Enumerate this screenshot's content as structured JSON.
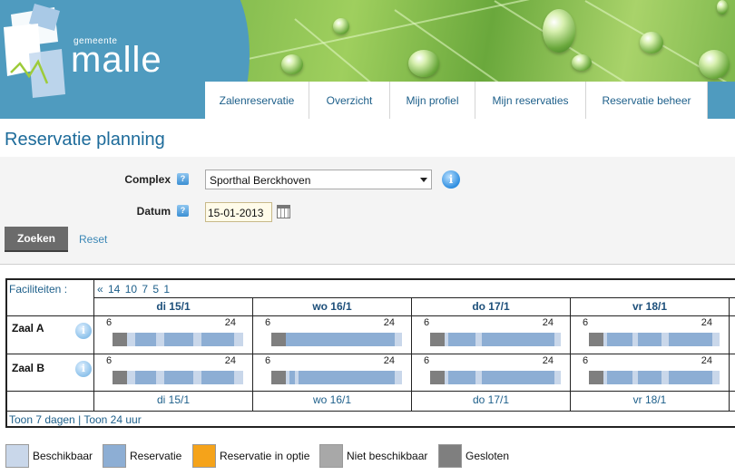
{
  "header": {
    "logo_small": "gemeente",
    "logo_big": "malle"
  },
  "nav": [
    {
      "label": "Zalenreservatie"
    },
    {
      "label": "Overzicht"
    },
    {
      "label": "Mijn profiel"
    },
    {
      "label": "Mijn reservaties"
    },
    {
      "label": "Reservatie beheer"
    }
  ],
  "page_title": "Reservatie planning",
  "form": {
    "complex_label": "Complex",
    "complex_value": "Sporthal Berckhoven",
    "datum_label": "Datum",
    "datum_value": "15-01-2013",
    "search_button": "Zoeken",
    "reset_link": "Reset"
  },
  "grid": {
    "facilities_label": "Faciliteiten :",
    "pager": "«  14  10  7  5  1",
    "days": [
      "di 15/1",
      "wo 16/1",
      "do 17/1",
      "vr 18/1"
    ],
    "rooms": [
      {
        "name": "Zaal A",
        "slots": [
          {
            "start_label": "6",
            "end_label": "24"
          },
          {
            "start_label": "6",
            "end_label": "24"
          },
          {
            "start_label": "6",
            "end_label": "24"
          },
          {
            "start_label": "6",
            "end_label": "24"
          }
        ]
      },
      {
        "name": "Zaal B",
        "slots": [
          {
            "start_label": "6",
            "end_label": "24"
          },
          {
            "start_label": "6",
            "end_label": "24"
          },
          {
            "start_label": "6",
            "end_label": "24"
          },
          {
            "start_label": "6",
            "end_label": "24"
          }
        ]
      }
    ],
    "footer_link_1": "Toon 7 dagen",
    "footer_sep": " | ",
    "footer_link_2": "Toon 24 uur"
  },
  "legend": [
    {
      "label": "Beschikbaar",
      "color": "#c9d7ea"
    },
    {
      "label": "Reservatie",
      "color": "#8daed4"
    },
    {
      "label": "Reservatie in optie",
      "color": "#f5a31a"
    },
    {
      "label": "Niet beschikbaar",
      "color": "#a8a8a8"
    },
    {
      "label": "Gesloten",
      "color": "#7f7f7f"
    }
  ],
  "icons": {
    "help": "help-icon",
    "info": "info-icon",
    "calendar": "calendar-icon"
  }
}
